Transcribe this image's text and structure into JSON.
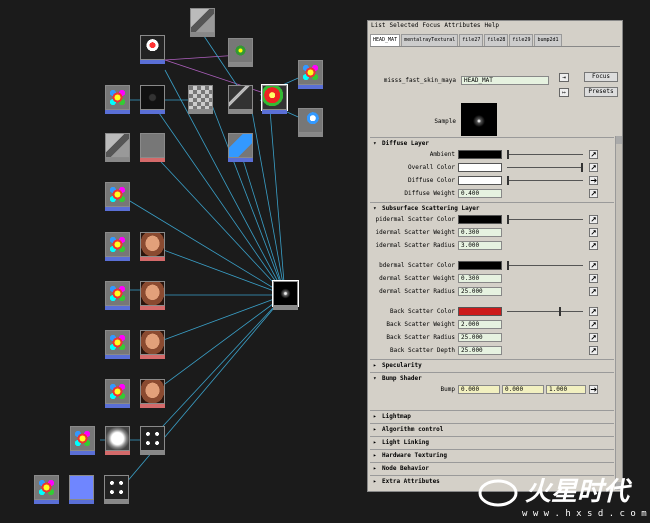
{
  "hypershade": {
    "nodes": [
      {
        "id": "n1",
        "tex": "t-cube",
        "lab": "gray"
      },
      {
        "id": "n2",
        "tex": "t-uvmap",
        "lab": "blue"
      },
      {
        "id": "n3",
        "tex": "t-target",
        "lab": "gray"
      },
      {
        "id": "n4",
        "tex": "t-flower",
        "lab": "blue"
      },
      {
        "id": "n5",
        "tex": "t-dark",
        "lab": "blue"
      },
      {
        "id": "n6",
        "tex": "t-checker",
        "lab": "gray"
      },
      {
        "id": "n7",
        "tex": "t-grid",
        "lab": "gray"
      },
      {
        "id": "n8",
        "tex": "t-red",
        "lab": "blue"
      },
      {
        "id": "n9",
        "tex": "t-flower",
        "lab": "blue"
      },
      {
        "id": "n10",
        "tex": "t-spheres",
        "lab": "gray"
      },
      {
        "id": "n11",
        "tex": "t-cube",
        "lab": "gray"
      },
      {
        "id": "n12",
        "tex": "t-blank",
        "lab": "red"
      },
      {
        "id": "n13",
        "tex": "t-tiles",
        "lab": "blue"
      },
      {
        "id": "n14",
        "tex": "t-flower",
        "lab": "blue"
      },
      {
        "id": "n15",
        "tex": "t-flower",
        "lab": "blue"
      },
      {
        "id": "n16",
        "tex": "t-face",
        "lab": "red"
      },
      {
        "id": "n17",
        "tex": "t-flower",
        "lab": "blue"
      },
      {
        "id": "n18",
        "tex": "t-face",
        "lab": "red"
      },
      {
        "id": "n19",
        "tex": "t-flower",
        "lab": "blue"
      },
      {
        "id": "n20",
        "tex": "t-face",
        "lab": "red"
      },
      {
        "id": "n21",
        "tex": "t-flower",
        "lab": "blue"
      },
      {
        "id": "n22",
        "tex": "t-face",
        "lab": "red"
      },
      {
        "id": "n23",
        "tex": "t-mat",
        "lab": "gray"
      },
      {
        "id": "n24",
        "tex": "t-flower",
        "lab": "blue"
      },
      {
        "id": "n25",
        "tex": "t-white",
        "lab": "red"
      },
      {
        "id": "n26",
        "tex": "t-dice",
        "lab": "gray"
      },
      {
        "id": "n27",
        "tex": "t-flower",
        "lab": "blue"
      },
      {
        "id": "n28",
        "tex": "t-blue",
        "lab": "blue"
      },
      {
        "id": "n29",
        "tex": "t-dice",
        "lab": "gray"
      }
    ]
  },
  "attribute_editor": {
    "menu": [
      "List",
      "Selected",
      "Focus",
      "Attributes",
      "Help"
    ],
    "tabs": [
      {
        "label": "HEAD_MAT",
        "active": true
      },
      {
        "label": "mentalrayTextural",
        "active": false
      },
      {
        "label": "file27",
        "active": false
      },
      {
        "label": "file28",
        "active": false
      },
      {
        "label": "file29",
        "active": false
      },
      {
        "label": "bump2d1",
        "active": false
      }
    ],
    "node_type_label": "misss_fast_skin_maya",
    "node_name": "HEAD_MAT",
    "focus_button": "Focus",
    "presets_button": "Presets",
    "sample_label": "Sample",
    "sections": {
      "diffuse": "Diffuse Layer",
      "subsurface": "Subsurface Scattering Layer",
      "specularity": "Specularity",
      "bump": "Bump Shader",
      "lightmap": "Lightmap",
      "algorithm": "Algorithm control",
      "light_linking": "Light Linking",
      "hardware": "Hardware Texturing",
      "node_behavior": "Node Behavior",
      "extra": "Extra Attributes"
    },
    "diffuse_rows": [
      {
        "label": "Ambient",
        "color": "#000000",
        "slider": 0.0
      },
      {
        "label": "Overall Color",
        "color": "#ffffff",
        "slider": 1.0
      },
      {
        "label": "Diffuse Color",
        "color": "#ffffff",
        "slider": 0.0
      },
      {
        "label": "Diffuse Weight",
        "value": "0.400"
      }
    ],
    "sss_rows_1": [
      {
        "label": "pidermal Scatter Color",
        "color": "#000000",
        "slider": 0.0
      },
      {
        "label": "idermal Scatter Weight",
        "value": "0.300"
      },
      {
        "label": "idermal Scatter Radius",
        "value": "3.000"
      }
    ],
    "sss_rows_2": [
      {
        "label": "bdermal Scatter Color",
        "color": "#000000",
        "slider": 0.0
      },
      {
        "label": "dermal Scatter Weight",
        "value": "0.300"
      },
      {
        "label": "dermal Scatter Radius",
        "value": "25.000"
      }
    ],
    "sss_rows_3": [
      {
        "label": "Back Scatter Color",
        "color": "#cc1a1a",
        "slider": 0.7
      },
      {
        "label": "Back Scatter Weight",
        "value": "2.000"
      },
      {
        "label": "Back Scatter Radius",
        "value": "25.000"
      },
      {
        "label": "Back Scatter Depth",
        "value": "25.000"
      }
    ],
    "bump": {
      "label": "Bump",
      "values": [
        "0.000",
        "0.000",
        "1.000"
      ]
    }
  },
  "watermark": {
    "brand": "火星时代",
    "url": "w w w . h x s d . c o m",
    "logo": "火星"
  }
}
